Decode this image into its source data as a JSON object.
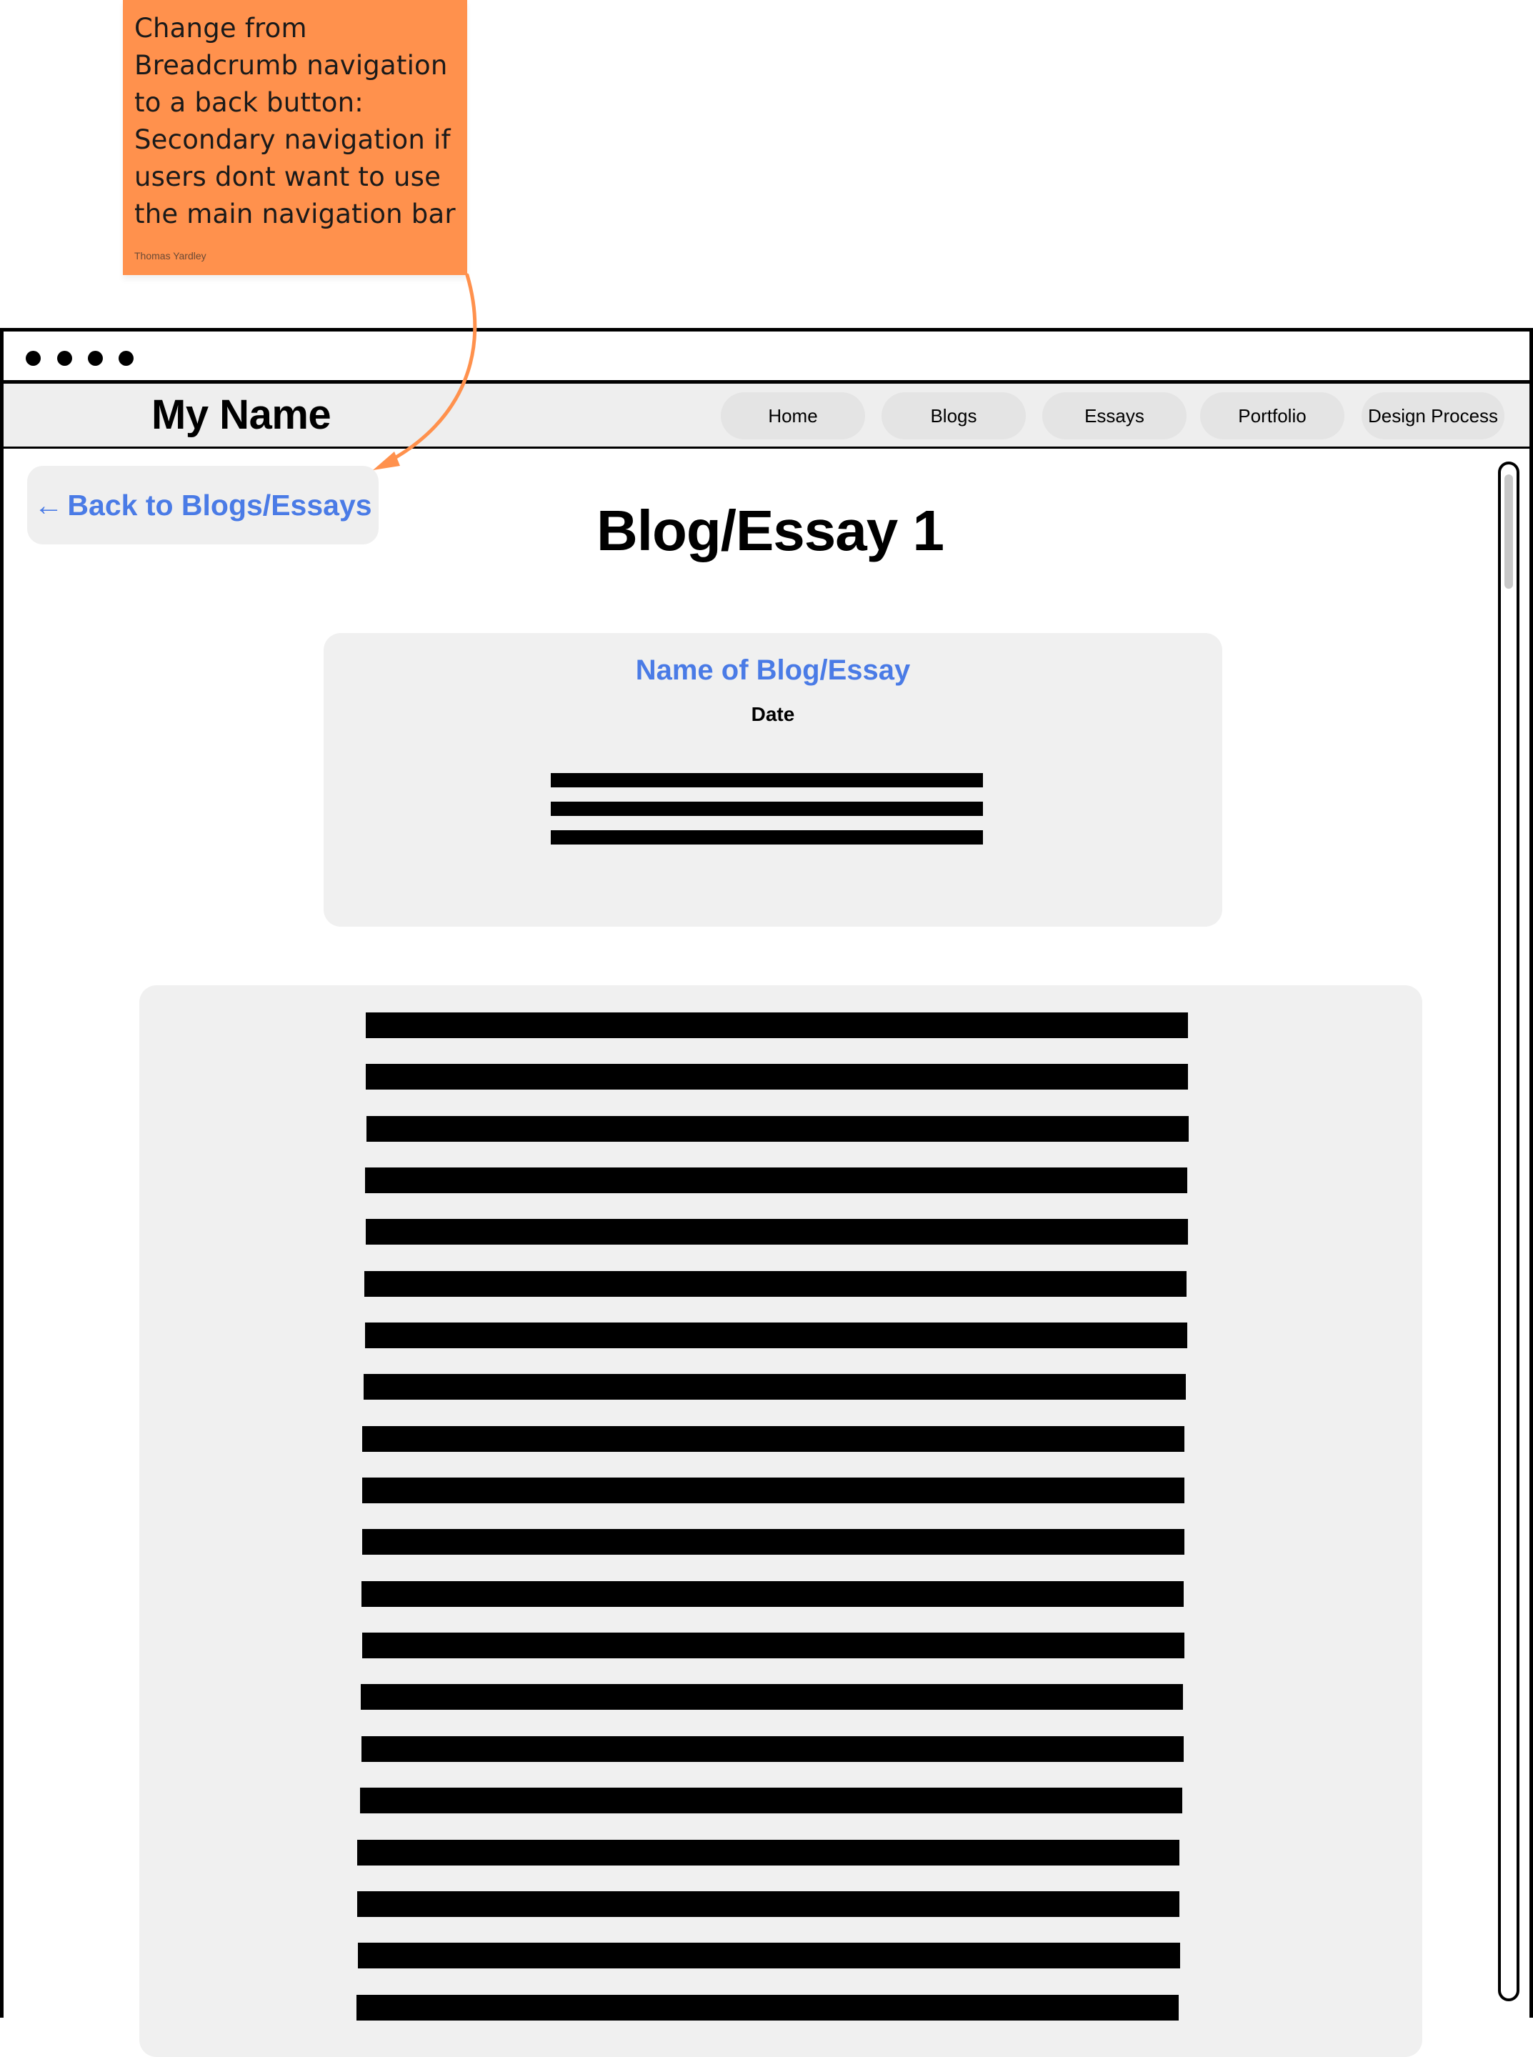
{
  "annotation": {
    "lines": [
      "Change from",
      "Breadcrumb navigation",
      "to a back button:",
      "Secondary navigation if",
      "users dont want to use",
      "the main navigation bar"
    ],
    "author": "Thomas Yardley",
    "note_color": "#ff914d"
  },
  "header": {
    "site_title": "My Name",
    "nav": [
      {
        "label": "Home"
      },
      {
        "label": "Blogs"
      },
      {
        "label": "Essays"
      },
      {
        "label": "Portfolio"
      },
      {
        "label": "Design Process"
      }
    ]
  },
  "back_button": {
    "arrow": "←",
    "label": "Back to Blogs/Essays"
  },
  "page": {
    "title": "Blog/Essay 1"
  },
  "info_card": {
    "title": "Name of Blog/Essay",
    "date": "Date"
  },
  "colors": {
    "accent": "#4a7be6",
    "card_bg": "#f0f0f0",
    "nav_bg": "#eeeeee",
    "annotation_arrow": "#ff914d"
  }
}
